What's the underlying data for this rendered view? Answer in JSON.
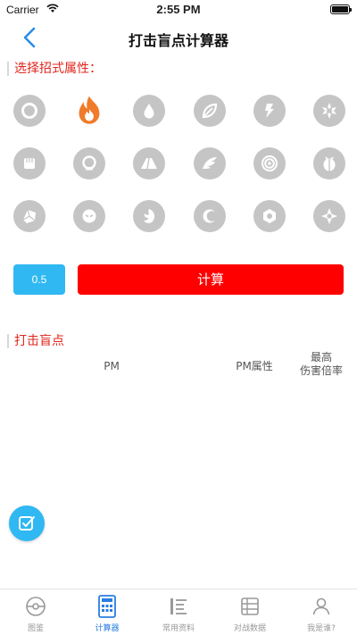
{
  "status_bar": {
    "carrier": "Carrier",
    "time": "2:55 PM"
  },
  "nav": {
    "title": "打击盲点计算器"
  },
  "attr_section": {
    "label": "选择招式属性："
  },
  "types": [
    {
      "icon": "normal-type-icon",
      "selected": false
    },
    {
      "icon": "fire-type-icon",
      "selected": true
    },
    {
      "icon": "water-type-icon",
      "selected": false
    },
    {
      "icon": "grass-type-icon",
      "selected": false
    },
    {
      "icon": "electric-type-icon",
      "selected": false
    },
    {
      "icon": "ice-type-icon",
      "selected": false
    },
    {
      "icon": "fighting-type-icon",
      "selected": false
    },
    {
      "icon": "poison-type-icon",
      "selected": false
    },
    {
      "icon": "ground-type-icon",
      "selected": false
    },
    {
      "icon": "flying-type-icon",
      "selected": false
    },
    {
      "icon": "psychic-type-icon",
      "selected": false
    },
    {
      "icon": "bug-type-icon",
      "selected": false
    },
    {
      "icon": "rock-type-icon",
      "selected": false
    },
    {
      "icon": "ghost-type-icon",
      "selected": false
    },
    {
      "icon": "dragon-type-icon",
      "selected": false
    },
    {
      "icon": "dark-type-icon",
      "selected": false
    },
    {
      "icon": "steel-type-icon",
      "selected": false
    },
    {
      "icon": "fairy-type-icon",
      "selected": false
    }
  ],
  "controls": {
    "multiplier": "0.5",
    "calculate": "计算"
  },
  "blind_section": {
    "label": "打击盲点"
  },
  "table": {
    "col_pm": "PM",
    "col_attr": "PM属性",
    "col_mult_line1": "最高",
    "col_mult_line2": "伤害倍率"
  },
  "tabs": [
    {
      "label": "图鉴",
      "icon": "pokeball-icon",
      "active": false
    },
    {
      "label": "计算器",
      "icon": "calculator-icon",
      "active": true
    },
    {
      "label": "常用资料",
      "icon": "list-icon",
      "active": false
    },
    {
      "label": "对战数据",
      "icon": "data-icon",
      "active": false
    },
    {
      "label": "我是谁?",
      "icon": "who-am-i-icon",
      "active": false
    }
  ],
  "colors": {
    "accent_blue": "#2fb8f2",
    "tab_active": "#2a7de1",
    "calc_red": "#ff0000",
    "label_red": "#e0261d",
    "type_gray": "#c5c5c5",
    "fire_orange": "#f07b2a"
  }
}
